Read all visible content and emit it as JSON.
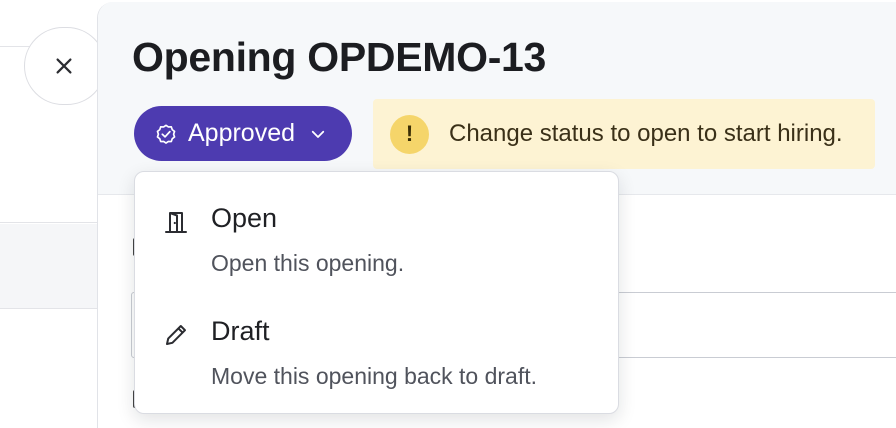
{
  "window": {
    "close_icon": "close-icon"
  },
  "drawer": {
    "title": "Opening OPDEMO-13",
    "status": {
      "label": "Approved",
      "icon": "check-circle-icon",
      "chevron_icon": "chevron-down-icon",
      "color": "#4d3bb0"
    },
    "warning": {
      "icon_glyph": "!",
      "text": "Change status to open to start hiring.",
      "background": "#fdf3d3"
    }
  },
  "status_menu": {
    "items": [
      {
        "icon": "door-icon",
        "title": "Open",
        "description": "Open this opening."
      },
      {
        "icon": "pencil-icon",
        "title": "Draft",
        "description": "Move this opening back to draft."
      }
    ]
  }
}
